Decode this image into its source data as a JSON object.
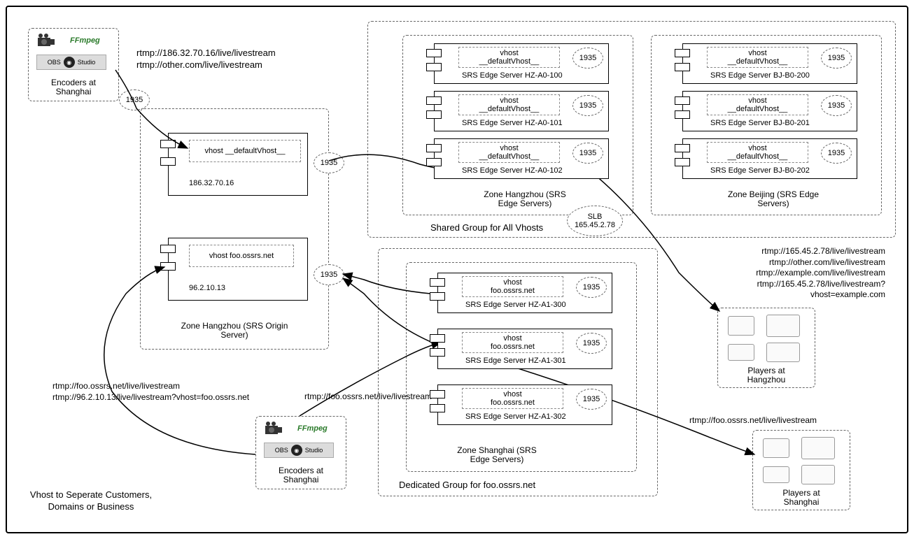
{
  "title": "Vhost to Seperate Customers, Domains or Business",
  "encoders": {
    "top": {
      "caption": "Encoders at\nShanghai",
      "ffmpeg": "FFmpeg",
      "obs_left": "OBS",
      "obs_right": "Studio"
    },
    "bottom": {
      "caption": "Encoders at\nShanghai",
      "ffmpeg": "FFmpeg",
      "obs_left": "OBS",
      "obs_right": "Studio"
    }
  },
  "urls": {
    "top_pair": "rtmp://186.32.70.16/live/livestream\nrtmp://other.com/live/livestream",
    "left_pair": "rtmp://foo.ossrs.net/live/livestream\nrtmp://96.2.10.13/live/livestream?vhost=foo.ossrs.net",
    "mid_single": "rtmp://foo.ossrs.net/live/livestream",
    "right_block": "rtmp://165.45.2.78/live/livestream\nrtmp://other.com/live/livestream\nrtmp://example.com/live/livestream\nrtmp://165.45.2.78/live/livestream?\nvhost=example.com",
    "right_single": "rtmp://foo.ossrs.net/live/livestream"
  },
  "origin_zone": {
    "caption": "Zone Hangzhou\n(SRS Origin Server)",
    "servers": [
      {
        "ip": "186.32.70.16",
        "vhost": "vhost __defaultVhost__"
      },
      {
        "ip": "96.2.10.13",
        "vhost": "vhost foo.ossrs.net"
      }
    ],
    "port_top": "1935",
    "port_mid": "1935",
    "port_bottom": "1935"
  },
  "shared_group": {
    "title": "Shared Group for All Vhosts",
    "zones": [
      {
        "name": "Zone Hangzhou\n(SRS Edge Servers)",
        "servers": [
          {
            "name": "SRS Edge Server HZ-A0-100",
            "vhost": "vhost\n__defaultVhost__",
            "port": "1935"
          },
          {
            "name": "SRS Edge Server HZ-A0-101",
            "vhost": "vhost\n__defaultVhost__",
            "port": "1935"
          },
          {
            "name": "SRS Edge Server HZ-A0-102",
            "vhost": "vhost\n__defaultVhost__",
            "port": "1935"
          }
        ]
      },
      {
        "name": "Zone Beijing\n(SRS Edge Servers)",
        "servers": [
          {
            "name": "SRS Edge Server BJ-B0-200",
            "vhost": "vhost\n__defaultVhost__",
            "port": "1935"
          },
          {
            "name": "SRS Edge Server BJ-B0-201",
            "vhost": "vhost\n__defaultVhost__",
            "port": "1935"
          },
          {
            "name": "SRS Edge Server BJ-B0-202",
            "vhost": "vhost\n__defaultVhost__",
            "port": "1935"
          }
        ]
      }
    ],
    "slb": "SLB\n165.45.2.78"
  },
  "dedicated_group": {
    "title": "Dedicated Group for foo.ossrs.net",
    "zone": {
      "name": "Zone Shanghai\n(SRS Edge Servers)",
      "servers": [
        {
          "name": "SRS Edge Server HZ-A1-300",
          "vhost": "vhost\nfoo.ossrs.net",
          "port": "1935"
        },
        {
          "name": "SRS Edge Server HZ-A1-301",
          "vhost": "vhost\nfoo.ossrs.net",
          "port": "1935"
        },
        {
          "name": "SRS Edge Server HZ-A1-302",
          "vhost": "vhost\nfoo.ossrs.net",
          "port": "1935"
        }
      ]
    }
  },
  "players": {
    "hangzhou": "Players at\nHangzhou",
    "shanghai": "Players at\nShanghai"
  }
}
